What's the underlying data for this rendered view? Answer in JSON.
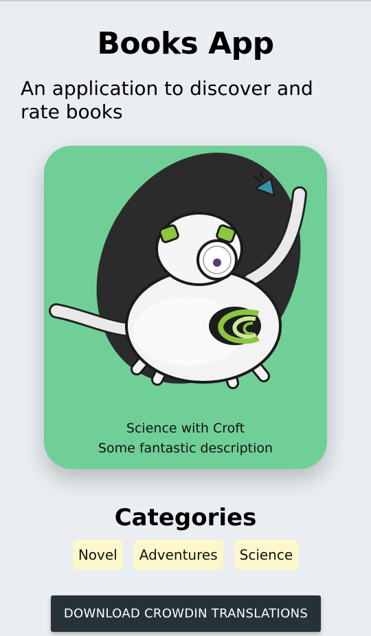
{
  "app": {
    "title": "Books App",
    "subtitle": "An application to discover and rate books"
  },
  "card": {
    "title": "Science with Croft",
    "description": "Some fantastic description",
    "background_color": "#70cf96",
    "image_icon": "robot-illustration"
  },
  "categories": {
    "heading": "Categories",
    "chip_color": "#fcf8cb",
    "items": [
      {
        "label": "Novel"
      },
      {
        "label": "Adventures"
      },
      {
        "label": "Science"
      }
    ]
  },
  "actions": {
    "download_label": "DOWNLOAD CROWDIN TRANSLATIONS",
    "button_color": "#263238"
  }
}
